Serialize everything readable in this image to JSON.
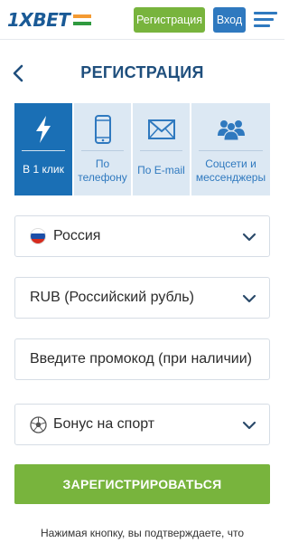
{
  "header": {
    "logo_text": "1XBET",
    "register_label": "Регистрация",
    "login_label": "Вход",
    "colors": {
      "brand_blue": "#2f79bf",
      "brand_green": "#78b43d"
    }
  },
  "page": {
    "title": "РЕГИСТРАЦИЯ"
  },
  "tabs": [
    {
      "label": "В 1 клик",
      "icon": "lightning-icon",
      "active": true
    },
    {
      "label": "По телефону",
      "icon": "phone-icon",
      "active": false
    },
    {
      "label": "По E-mail",
      "icon": "envelope-icon",
      "active": false
    },
    {
      "label": "Соцсети и мессенджеры",
      "icon": "people-icon",
      "active": false
    }
  ],
  "form": {
    "country": {
      "value": "Россия",
      "icon": "russia-flag-icon"
    },
    "currency": {
      "value": "RUB (Российский рубль)"
    },
    "promo": {
      "placeholder": "Введите промокод (при наличии)"
    },
    "bonus": {
      "value": "Бонус на спорт",
      "icon": "soccer-ball-icon"
    }
  },
  "submit_label": "ЗАРЕГИСТРИРОВАТЬСЯ",
  "footnote": "Нажимая кнопку, вы подтверждаете, что"
}
